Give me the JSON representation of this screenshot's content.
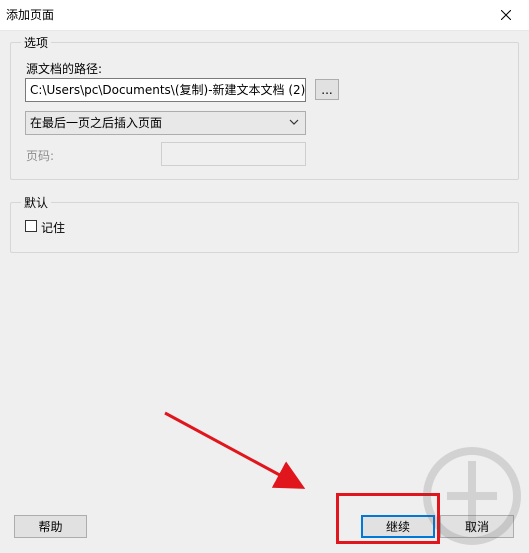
{
  "window": {
    "title": "添加页面"
  },
  "options_group": {
    "legend": "选项",
    "source_label": "源文档的路径:",
    "source_path": "C:\\Users\\pc\\Documents\\(复制)-新建文本文档 (2)",
    "browse_label": "...",
    "insert_mode": "在最后一页之后插入页面",
    "page_label": "页码:",
    "page_value": ""
  },
  "defaults_group": {
    "legend": "默认",
    "remember_label": "记住",
    "remember_checked": false
  },
  "footer": {
    "help_label": "帮助",
    "continue_label": "继续",
    "cancel_label": "取消"
  },
  "colors": {
    "annotation_red": "#e0161c",
    "focus_blue": "#0078d7"
  }
}
